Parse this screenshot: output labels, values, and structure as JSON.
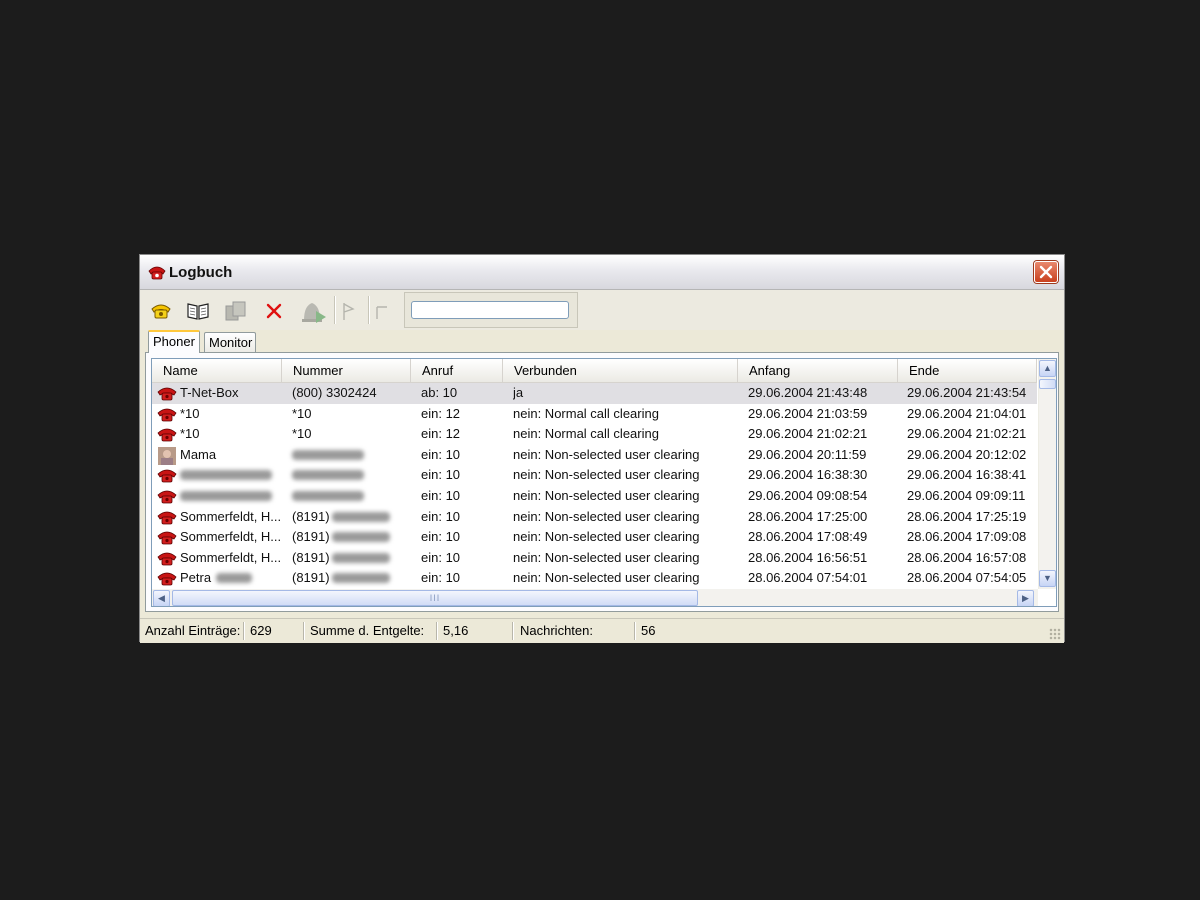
{
  "window": {
    "title": "Logbuch",
    "app_icon": "phone-icon",
    "close_icon": "close-icon"
  },
  "toolbar": {
    "buttons": [
      {
        "icon": "dial-phone-icon",
        "enabled": true
      },
      {
        "icon": "address-book-icon",
        "enabled": true
      },
      {
        "icon": "copy-icon",
        "enabled": false
      },
      {
        "icon": "delete-icon",
        "enabled": true
      },
      {
        "icon": "callback-bell-icon",
        "enabled": false
      },
      {
        "icon": "flag-icon",
        "enabled": false
      },
      {
        "icon": "unflag-icon",
        "enabled": false
      }
    ],
    "search": {
      "value": "",
      "placeholder": ""
    }
  },
  "tabs": [
    {
      "label": "Phoner",
      "active": true
    },
    {
      "label": "Monitor",
      "active": false
    }
  ],
  "table": {
    "columns": [
      "Name",
      "Nummer",
      "Anruf",
      "Verbunden",
      "Anfang",
      "Ende"
    ],
    "rows": [
      {
        "icon": "phone-icon",
        "name": "T-Net-Box",
        "nummer": "(800) 3302424",
        "anruf": "ab: 10",
        "verbunden": "ja",
        "anfang": "29.06.2004 21:43:48",
        "ende": "29.06.2004 21:43:54",
        "selected": true
      },
      {
        "icon": "phone-icon",
        "name": "*10",
        "nummer": "*10",
        "anruf": "ein: 12",
        "verbunden": "nein: Normal call clearing",
        "anfang": "29.06.2004 21:03:59",
        "ende": "29.06.2004 21:04:01"
      },
      {
        "icon": "phone-icon",
        "name": "*10",
        "nummer": "*10",
        "anruf": "ein: 12",
        "verbunden": "nein: Normal call clearing",
        "anfang": "29.06.2004 21:02:21",
        "ende": "29.06.2004 21:02:21"
      },
      {
        "icon": "contact-photo-icon",
        "name": "Mama",
        "nummer": "",
        "anruf": "ein: 10",
        "verbunden": "nein: Non-selected user clearing",
        "anfang": "29.06.2004 20:11:59",
        "ende": "29.06.2004 20:12:02"
      },
      {
        "icon": "phone-icon",
        "name": "",
        "nummer": "",
        "anruf": "ein: 10",
        "verbunden": "nein: Non-selected user clearing",
        "anfang": "29.06.2004 16:38:30",
        "ende": "29.06.2004 16:38:41"
      },
      {
        "icon": "phone-icon",
        "name": "",
        "nummer": "",
        "anruf": "ein: 10",
        "verbunden": "nein: Non-selected user clearing",
        "anfang": "29.06.2004 09:08:54",
        "ende": "29.06.2004 09:09:11"
      },
      {
        "icon": "phone-icon",
        "name": "Sommerfeldt, H...",
        "nummer": "(8191)",
        "anruf": "ein: 10",
        "verbunden": "nein: Non-selected user clearing",
        "anfang": "28.06.2004 17:25:00",
        "ende": "28.06.2004 17:25:19"
      },
      {
        "icon": "phone-icon",
        "name": "Sommerfeldt, H...",
        "nummer": "(8191)",
        "anruf": "ein: 10",
        "verbunden": "nein: Non-selected user clearing",
        "anfang": "28.06.2004 17:08:49",
        "ende": "28.06.2004 17:09:08"
      },
      {
        "icon": "phone-icon",
        "name": "Sommerfeldt, H...",
        "nummer": "(8191)",
        "anruf": "ein: 10",
        "verbunden": "nein: Non-selected user clearing",
        "anfang": "28.06.2004 16:56:51",
        "ende": "28.06.2004 16:57:08"
      },
      {
        "icon": "phone-icon",
        "name": "Petra",
        "nummer": "(8191)",
        "anruf": "ein: 10",
        "verbunden": "nein: Non-selected user clearing",
        "anfang": "28.06.2004 07:54:01",
        "ende": "28.06.2004 07:54:05"
      }
    ]
  },
  "scrollbars": {
    "up_icon": "scroll-up-icon",
    "down_icon": "scroll-down-icon",
    "left_icon": "scroll-left-icon",
    "right_icon": "scroll-right-icon",
    "grip_text": "III"
  },
  "statusbar": {
    "entries_label": "Anzahl Einträge:",
    "entries_value": "629",
    "fees_label": "Summe d. Entgelte:",
    "fees_value": "5,16",
    "messages_label": "Nachrichten:",
    "messages_value": "56"
  },
  "colors": {
    "desktop": "#1c1c1c",
    "window_face": "#ece9d8",
    "selected_row": "#e0dfe3",
    "close_button": "#d9532d",
    "phone_red": "#c81414",
    "tab_highlight": "#ffc83c"
  }
}
